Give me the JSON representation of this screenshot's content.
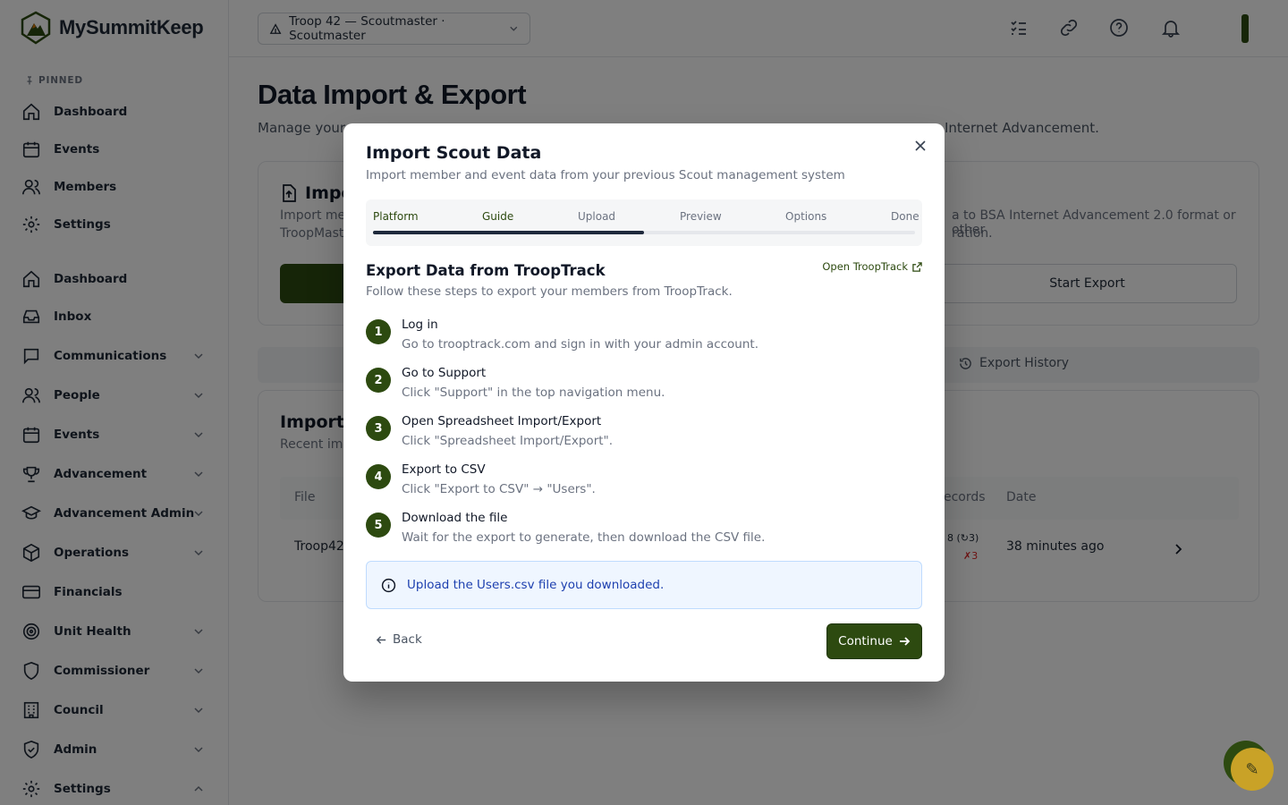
{
  "brand": {
    "name": "MySummitKeep"
  },
  "sidebar": {
    "pinned_label": "PINNED",
    "pinned": [
      {
        "label": "Dashboard"
      },
      {
        "label": "Events"
      },
      {
        "label": "Members"
      },
      {
        "label": "Settings"
      }
    ],
    "items": [
      {
        "label": "Dashboard"
      },
      {
        "label": "Inbox"
      },
      {
        "label": "Communications"
      },
      {
        "label": "People"
      },
      {
        "label": "Events"
      },
      {
        "label": "Advancement"
      },
      {
        "label": "Advancement Admin"
      },
      {
        "label": "Operations"
      },
      {
        "label": "Financials"
      },
      {
        "label": "Unit Health"
      },
      {
        "label": "Commissioner"
      },
      {
        "label": "Council"
      },
      {
        "label": "Admin"
      },
      {
        "label": "Settings"
      }
    ]
  },
  "topbar": {
    "unit_selector": "Troop 42 — Scoutmaster · Scoutmaster"
  },
  "page": {
    "title": "Data Import & Export",
    "subtitle_left": "Manage your",
    "subtitle_right": "Internet Advancement.",
    "import_card_title": "Impo",
    "import_card_desc_1": "Import mem",
    "import_card_desc_2": "TroopMaste",
    "export_card_desc_1": "a to BSA Internet Advancement 2.0 format or other",
    "export_card_desc_2": "ration.",
    "start_export": "Start Export",
    "export_history_tab": "Export History",
    "history_title": "Import H",
    "history_sub": "Recent impo",
    "history_cols": {
      "file": "File",
      "records": "ecords",
      "date": "Date"
    },
    "history_row": {
      "file": "Troop42_",
      "records_ok": "8 (↻3)",
      "records_err": "✗3",
      "date": "38 minutes ago"
    }
  },
  "dialog": {
    "title": "Import Scout Data",
    "subtitle": "Import member and event data from your previous Scout management system",
    "steps": [
      "Platform",
      "Guide",
      "Upload",
      "Preview",
      "Options",
      "Done"
    ],
    "progress": 0.5,
    "guide_title": "Export Data from TroopTrack",
    "guide_sub": "Follow these steps to export your members from TroopTrack.",
    "open_link": "Open TroopTrack",
    "guide_steps": [
      {
        "num": "1",
        "title": "Log in",
        "desc": "Go to trooptrack.com and sign in with your admin account."
      },
      {
        "num": "2",
        "title": "Go to Support",
        "desc": "Click \"Support\" in the top navigation menu."
      },
      {
        "num": "3",
        "title": "Open Spreadsheet Import/Export",
        "desc": "Click \"Spreadsheet Import/Export\"."
      },
      {
        "num": "4",
        "title": "Export to CSV",
        "desc": "Click \"Export to CSV\" → \"Users\"."
      },
      {
        "num": "5",
        "title": "Download the file",
        "desc": "Wait for the export to generate, then download the CSV file."
      }
    ],
    "info": "Upload the Users.csv file you downloaded.",
    "back": "Back",
    "continue": "Continue"
  },
  "colors": {
    "brand_green": "#2d4a10",
    "info_blue": "#1e40af"
  }
}
